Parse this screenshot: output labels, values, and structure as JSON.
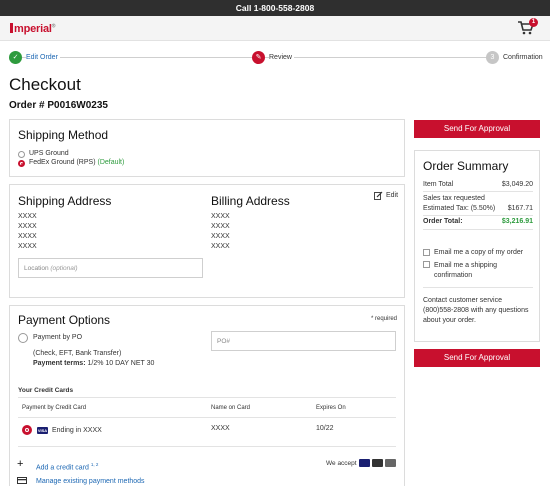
{
  "topbar": {
    "phone": "Call 1-800-558-2808"
  },
  "header": {
    "logo": "mperial",
    "logo_mark": "®",
    "cart_count": "1"
  },
  "steps": [
    {
      "label": "Edit Order",
      "icon": "check-icon"
    },
    {
      "label": "Review",
      "icon": "pencil-icon"
    },
    {
      "label": "Confirmation",
      "icon": "number-icon",
      "number": "3"
    }
  ],
  "page": {
    "title": "Checkout",
    "order_number": "Order # P0016W0235"
  },
  "shipping_method": {
    "title": "Shipping Method",
    "options": [
      {
        "label": "UPS Ground",
        "selected": false
      },
      {
        "label": "FedEx Ground (RPS)",
        "suffix": "(Default)",
        "selected": true
      }
    ]
  },
  "shipping_address": {
    "title": "Shipping Address",
    "lines": [
      "XXXX",
      "XXXX",
      "XXXX",
      "XXXX"
    ],
    "location_placeholder": "Location",
    "location_hint": "(optional)"
  },
  "billing_address": {
    "title": "Billing Address",
    "lines": [
      "XXXX",
      "XXXX",
      "XXXX",
      "XXXX"
    ],
    "edit_label": "Edit"
  },
  "payment": {
    "title": "Payment Options",
    "required": "* required",
    "po_option": "Payment by PO",
    "po_desc": "(Check, EFT, Bank Transfer)",
    "terms_label": "Payment terms:",
    "terms_value": "1/2% 10 DAY NET 30",
    "po_placeholder": "PO#",
    "cards_title": "Your Credit Cards",
    "columns": [
      "Payment by Credit Card",
      "Name on Card",
      "Expires On"
    ],
    "card": {
      "brand": "VISA",
      "ending": "Ending in XXXX",
      "name": "XXXX",
      "expires": "10/22"
    },
    "add_card": "Add a credit card",
    "add_card_sup": "1, 2",
    "manage": "Manage existing payment methods",
    "we_accept": "We accept"
  },
  "summary": {
    "title": "Order Summary",
    "item_total_label": "Item Total",
    "item_total": "$3,049.20",
    "tax_label_1": "Sales tax requested",
    "tax_label_2": "Estimated Tax: (5.50%)",
    "tax": "$167.71",
    "order_total_label": "Order Total:",
    "order_total": "$3,216.91",
    "email_copy": "Email me a copy of my order",
    "email_ship_1": "Email me a shipping",
    "email_ship_2": "confirmation",
    "contact": "Contact customer service (800)558-2808 with any questions about your order."
  },
  "actions": {
    "send_for_approval": "Send For Approval"
  },
  "colors": {
    "accent_red": "#c8102e",
    "link_blue": "#1c67b3",
    "success_green": "#2e9b3e"
  }
}
